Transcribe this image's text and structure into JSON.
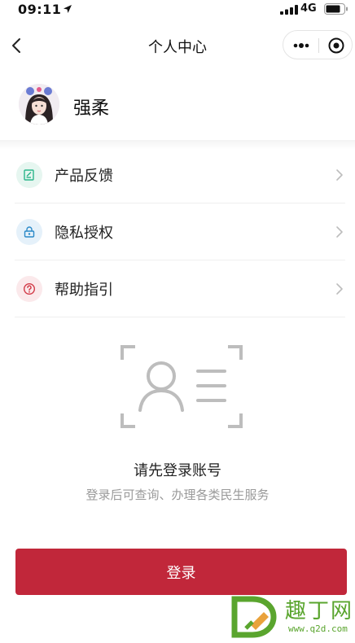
{
  "status_bar": {
    "time": "09:11",
    "network": "4G"
  },
  "nav": {
    "title": "个人中心"
  },
  "profile": {
    "name": "强柔"
  },
  "menu": {
    "items": [
      {
        "label": "产品反馈",
        "icon": "edit-icon",
        "color": "#2bb58a",
        "bg": "#e6f6f0"
      },
      {
        "label": "隐私授权",
        "icon": "lock-icon",
        "color": "#2a89c8",
        "bg": "#e5f1fa"
      },
      {
        "label": "帮助指引",
        "icon": "help-icon",
        "color": "#d23b48",
        "bg": "#fbe9eb"
      }
    ]
  },
  "empty_state": {
    "title": "请先登录账号",
    "description": "登录后可查询、办理各类民生服务"
  },
  "login": {
    "label": "登录"
  },
  "watermark": {
    "text": "趣丁网",
    "url": "www.q2d.com"
  },
  "colors": {
    "primary": "#c1273a",
    "text": "#222222",
    "muted": "#9a9a9a"
  }
}
